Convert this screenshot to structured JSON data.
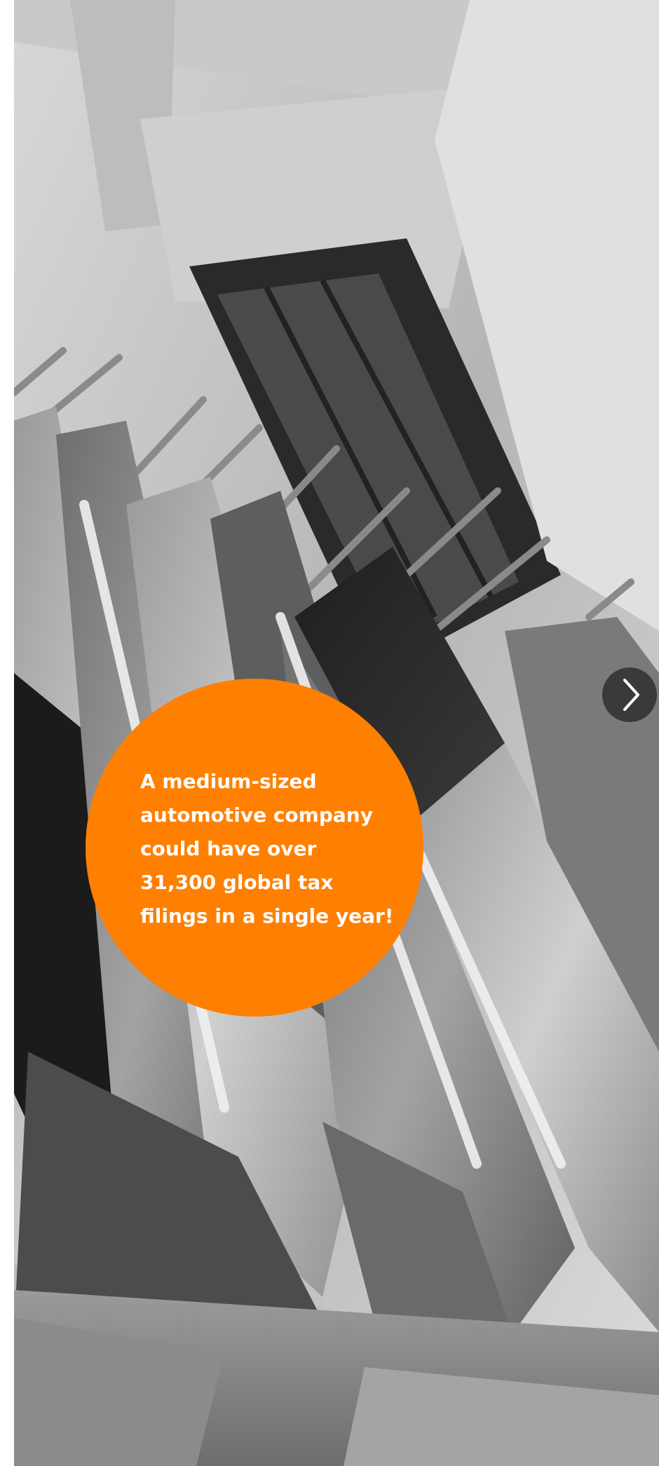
{
  "hero": {
    "image_icon": "photo-flags-on-building-facade",
    "callout": {
      "color": "#ff7f00",
      "lines": [
        "A medium-sized",
        "automotive company",
        "could have over",
        "31,300 global tax",
        "filings in a single year!"
      ]
    },
    "next_button": {
      "icon": "chevron-right-icon",
      "color": "#3a3a3a"
    }
  }
}
